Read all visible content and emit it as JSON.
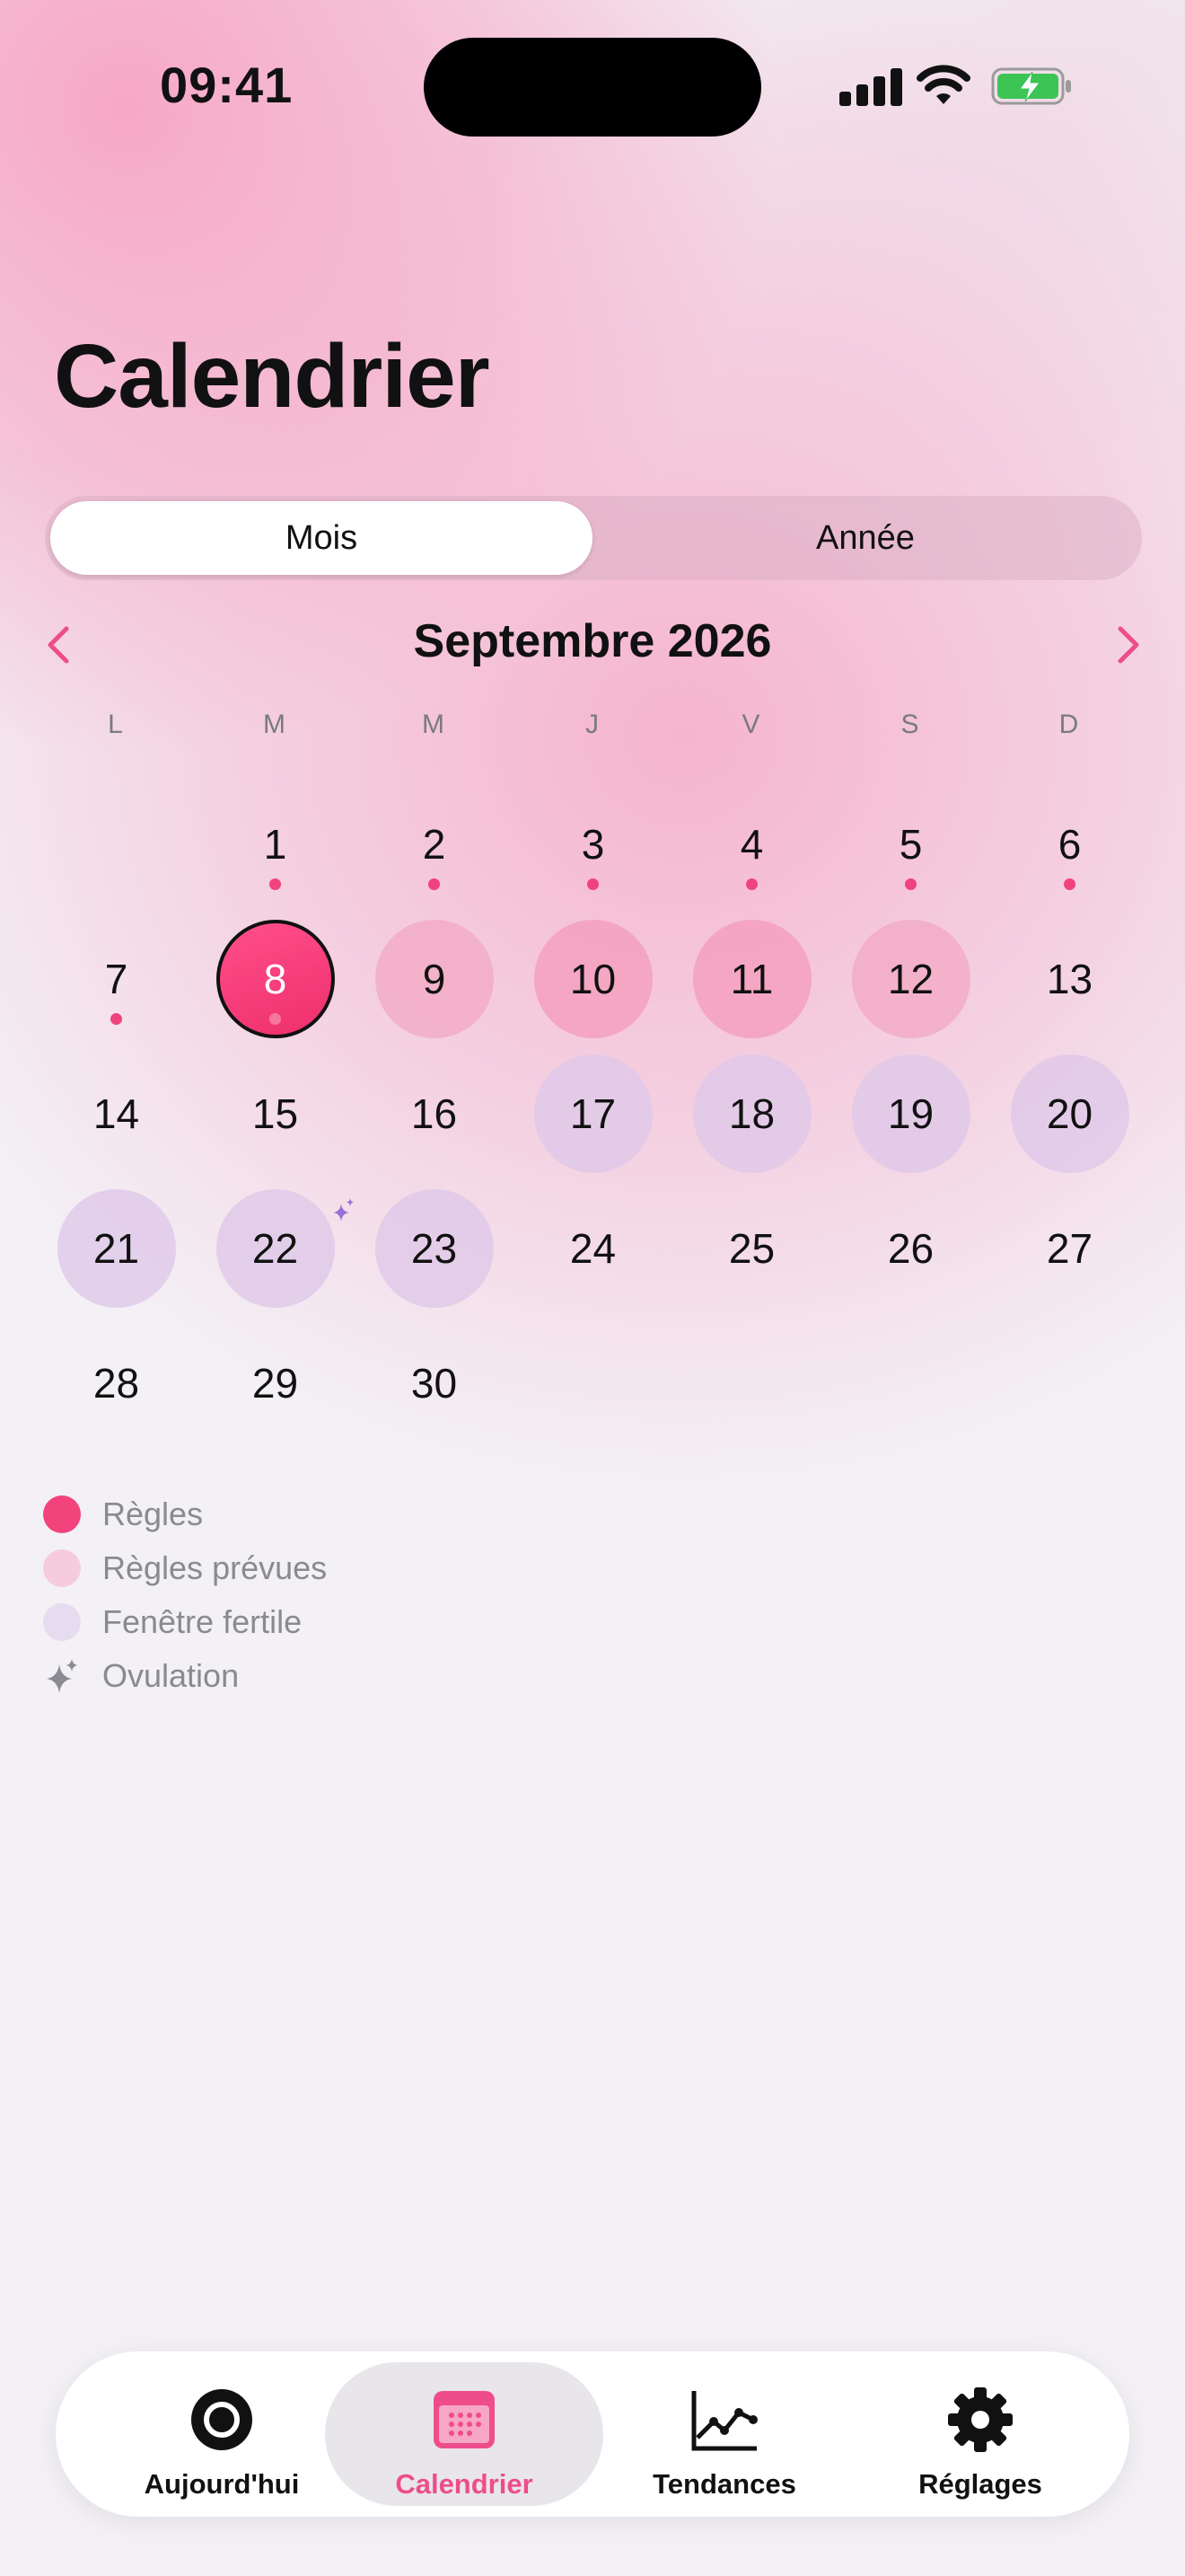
{
  "status_bar": {
    "time": "09:41"
  },
  "page": {
    "title": "Calendrier"
  },
  "segmented": {
    "options": [
      "Mois",
      "Année"
    ],
    "selected": "Mois"
  },
  "calendar": {
    "month_label": "Septembre 2026",
    "weekdays": [
      "L",
      "M",
      "M",
      "J",
      "V",
      "S",
      "D"
    ],
    "days": [
      {
        "n": "",
        "type": "empty"
      },
      {
        "n": "1",
        "type": "logged"
      },
      {
        "n": "2",
        "type": "logged"
      },
      {
        "n": "3",
        "type": "logged"
      },
      {
        "n": "4",
        "type": "logged"
      },
      {
        "n": "5",
        "type": "logged"
      },
      {
        "n": "6",
        "type": "logged"
      },
      {
        "n": "7",
        "type": "logged"
      },
      {
        "n": "8",
        "type": "today"
      },
      {
        "n": "9",
        "type": "predicted"
      },
      {
        "n": "10",
        "type": "predicted"
      },
      {
        "n": "11",
        "type": "predicted"
      },
      {
        "n": "12",
        "type": "predicted"
      },
      {
        "n": "13",
        "type": "normal"
      },
      {
        "n": "14",
        "type": "normal"
      },
      {
        "n": "15",
        "type": "normal"
      },
      {
        "n": "16",
        "type": "normal"
      },
      {
        "n": "17",
        "type": "fertile"
      },
      {
        "n": "18",
        "type": "fertile"
      },
      {
        "n": "19",
        "type": "fertile"
      },
      {
        "n": "20",
        "type": "fertile"
      },
      {
        "n": "21",
        "type": "fertile"
      },
      {
        "n": "22",
        "type": "ovulation"
      },
      {
        "n": "23",
        "type": "fertile"
      },
      {
        "n": "24",
        "type": "normal"
      },
      {
        "n": "25",
        "type": "normal"
      },
      {
        "n": "26",
        "type": "normal"
      },
      {
        "n": "27",
        "type": "normal"
      },
      {
        "n": "28",
        "type": "normal"
      },
      {
        "n": "29",
        "type": "normal"
      },
      {
        "n": "30",
        "type": "normal"
      }
    ]
  },
  "legend": [
    {
      "label": "Règles",
      "color": "#f2437d",
      "kind": "period"
    },
    {
      "label": "Règles prévues",
      "color": "#f6cbdc",
      "kind": "predicted"
    },
    {
      "label": "Fenêtre fertile",
      "color": "#e5dcef",
      "kind": "fertile"
    },
    {
      "label": "Ovulation",
      "icon": "sparkle-icon",
      "kind": "ovulation"
    }
  ],
  "tabbar": {
    "items": [
      {
        "label": "Aujourd'hui",
        "icon": "ring-icon"
      },
      {
        "label": "Calendrier",
        "icon": "calendar-icon",
        "active": true
      },
      {
        "label": "Tendances",
        "icon": "chart-icon"
      },
      {
        "label": "Réglages",
        "icon": "gear-icon"
      }
    ]
  },
  "colors": {
    "accent": "#ee4d8a",
    "period": "#f0437d",
    "predicted": "#f3a5c2",
    "fertile": "#decae8",
    "ovulation": "#9b6fd8"
  }
}
